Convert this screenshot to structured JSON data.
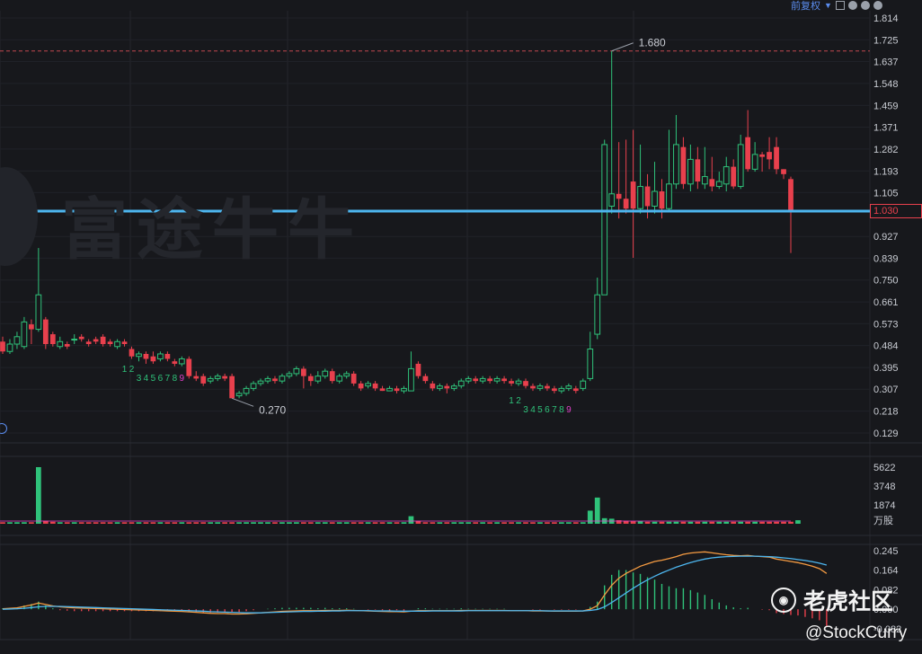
{
  "toolbar": {
    "adjust_label": "前复权",
    "chevron": "chevron-down-icon"
  },
  "watermark": {
    "text": "富途牛牛"
  },
  "community": {
    "name": "老虎社区",
    "handle": "@StockCurry"
  },
  "colors": {
    "up": "#2fc27a",
    "down": "#e8404d",
    "ma_line": "#4db6ef",
    "dif": "#f59b42",
    "dea": "#4db6ef",
    "vol_ma": "#e040c8"
  },
  "chart_data": [
    {
      "type": "candlestick",
      "price_axis_ticks": [
        "1.814",
        "1.725",
        "1.637",
        "1.548",
        "1.459",
        "1.371",
        "1.282",
        "1.193",
        "1.105",
        "1.030",
        "0.927",
        "0.839",
        "0.750",
        "0.661",
        "0.573",
        "0.484",
        "0.395",
        "0.307",
        "0.218",
        "0.129"
      ],
      "ylim": [
        0.129,
        1.814
      ],
      "current_price": 1.03,
      "current_price_label": "1.030",
      "high_marker": {
        "value": 1.68,
        "label": "1.680"
      },
      "low_marker": {
        "value": 0.27,
        "label": "0.270"
      },
      "candles": [
        [
          0.5,
          0.46,
          0.52,
          0.45
        ],
        [
          0.46,
          0.49,
          0.51,
          0.45
        ],
        [
          0.49,
          0.52,
          0.54,
          0.47
        ],
        [
          0.48,
          0.58,
          0.6,
          0.47
        ],
        [
          0.57,
          0.55,
          0.59,
          0.49
        ],
        [
          0.55,
          0.69,
          0.88,
          0.54
        ],
        [
          0.59,
          0.49,
          0.6,
          0.47
        ],
        [
          0.53,
          0.49,
          0.54,
          0.48
        ],
        [
          0.48,
          0.5,
          0.52,
          0.47
        ],
        [
          0.49,
          0.48,
          0.5,
          0.47
        ],
        [
          0.51,
          0.51,
          0.53,
          0.49
        ],
        [
          0.52,
          0.51,
          0.53,
          0.5
        ],
        [
          0.5,
          0.49,
          0.51,
          0.48
        ],
        [
          0.51,
          0.5,
          0.52,
          0.49
        ],
        [
          0.52,
          0.49,
          0.53,
          0.48
        ],
        [
          0.5,
          0.49,
          0.51,
          0.48
        ],
        [
          0.48,
          0.5,
          0.51,
          0.47
        ],
        [
          0.5,
          0.49,
          0.51,
          0.48
        ],
        [
          0.47,
          0.44,
          0.48,
          0.43
        ],
        [
          0.44,
          0.45,
          0.46,
          0.42
        ],
        [
          0.45,
          0.43,
          0.46,
          0.41
        ],
        [
          0.44,
          0.42,
          0.46,
          0.41
        ],
        [
          0.43,
          0.45,
          0.46,
          0.42
        ],
        [
          0.45,
          0.43,
          0.46,
          0.42
        ],
        [
          0.42,
          0.41,
          0.43,
          0.4
        ],
        [
          0.41,
          0.43,
          0.44,
          0.4
        ],
        [
          0.43,
          0.36,
          0.44,
          0.35
        ],
        [
          0.36,
          0.35,
          0.38,
          0.34
        ],
        [
          0.36,
          0.33,
          0.37,
          0.32
        ],
        [
          0.34,
          0.35,
          0.36,
          0.33
        ],
        [
          0.35,
          0.36,
          0.37,
          0.34
        ],
        [
          0.36,
          0.35,
          0.37,
          0.34
        ],
        [
          0.36,
          0.27,
          0.37,
          0.27
        ],
        [
          0.28,
          0.29,
          0.3,
          0.27
        ],
        [
          0.29,
          0.31,
          0.32,
          0.28
        ],
        [
          0.31,
          0.33,
          0.34,
          0.3
        ],
        [
          0.33,
          0.34,
          0.35,
          0.32
        ],
        [
          0.34,
          0.35,
          0.36,
          0.33
        ],
        [
          0.35,
          0.34,
          0.36,
          0.33
        ],
        [
          0.34,
          0.36,
          0.37,
          0.33
        ],
        [
          0.36,
          0.37,
          0.38,
          0.35
        ],
        [
          0.37,
          0.39,
          0.4,
          0.36
        ],
        [
          0.39,
          0.36,
          0.4,
          0.31
        ],
        [
          0.36,
          0.34,
          0.37,
          0.32
        ],
        [
          0.34,
          0.36,
          0.38,
          0.33
        ],
        [
          0.36,
          0.38,
          0.39,
          0.35
        ],
        [
          0.38,
          0.34,
          0.39,
          0.33
        ],
        [
          0.34,
          0.36,
          0.37,
          0.33
        ],
        [
          0.36,
          0.37,
          0.38,
          0.35
        ],
        [
          0.37,
          0.33,
          0.38,
          0.32
        ],
        [
          0.33,
          0.31,
          0.34,
          0.3
        ],
        [
          0.32,
          0.33,
          0.34,
          0.31
        ],
        [
          0.33,
          0.31,
          0.34,
          0.3
        ],
        [
          0.31,
          0.3,
          0.32,
          0.3
        ],
        [
          0.3,
          0.31,
          0.32,
          0.3
        ],
        [
          0.31,
          0.3,
          0.32,
          0.29
        ],
        [
          0.3,
          0.31,
          0.32,
          0.29
        ],
        [
          0.3,
          0.39,
          0.46,
          0.3
        ],
        [
          0.41,
          0.36,
          0.42,
          0.35
        ],
        [
          0.36,
          0.34,
          0.37,
          0.33
        ],
        [
          0.33,
          0.31,
          0.34,
          0.3
        ],
        [
          0.31,
          0.32,
          0.33,
          0.3
        ],
        [
          0.32,
          0.31,
          0.33,
          0.29
        ],
        [
          0.31,
          0.32,
          0.33,
          0.3
        ],
        [
          0.32,
          0.34,
          0.35,
          0.31
        ],
        [
          0.34,
          0.35,
          0.36,
          0.33
        ],
        [
          0.35,
          0.34,
          0.36,
          0.33
        ],
        [
          0.34,
          0.35,
          0.36,
          0.33
        ],
        [
          0.35,
          0.34,
          0.36,
          0.33
        ],
        [
          0.34,
          0.35,
          0.36,
          0.33
        ],
        [
          0.35,
          0.34,
          0.36,
          0.33
        ],
        [
          0.34,
          0.33,
          0.35,
          0.32
        ],
        [
          0.33,
          0.34,
          0.35,
          0.32
        ],
        [
          0.34,
          0.32,
          0.35,
          0.31
        ],
        [
          0.32,
          0.31,
          0.33,
          0.3
        ],
        [
          0.31,
          0.32,
          0.33,
          0.3
        ],
        [
          0.32,
          0.31,
          0.33,
          0.3
        ],
        [
          0.31,
          0.3,
          0.32,
          0.29
        ],
        [
          0.3,
          0.31,
          0.32,
          0.29
        ],
        [
          0.31,
          0.32,
          0.33,
          0.3
        ],
        [
          0.31,
          0.3,
          0.32,
          0.29
        ],
        [
          0.31,
          0.34,
          0.35,
          0.3
        ],
        [
          0.35,
          0.47,
          0.54,
          0.34
        ],
        [
          0.53,
          0.69,
          0.76,
          0.51
        ],
        [
          0.69,
          1.3,
          1.32,
          0.69
        ],
        [
          1.05,
          1.1,
          1.68,
          1.02
        ],
        [
          1.1,
          1.08,
          1.31,
          1.0
        ],
        [
          1.08,
          1.04,
          1.32,
          1.02
        ],
        [
          1.15,
          1.04,
          1.36,
          0.84
        ],
        [
          1.04,
          1.13,
          1.3,
          1.02
        ],
        [
          1.13,
          1.05,
          1.18,
          1.0
        ],
        [
          1.05,
          1.11,
          1.23,
          1.02
        ],
        [
          1.11,
          1.04,
          1.16,
          1.0
        ],
        [
          1.04,
          1.14,
          1.36,
          1.03
        ],
        [
          1.14,
          1.3,
          1.42,
          1.12
        ],
        [
          1.29,
          1.14,
          1.33,
          1.12
        ],
        [
          1.14,
          1.24,
          1.3,
          1.11
        ],
        [
          1.24,
          1.15,
          1.29,
          1.12
        ],
        [
          1.14,
          1.17,
          1.29,
          1.12
        ],
        [
          1.16,
          1.13,
          1.25,
          1.11
        ],
        [
          1.13,
          1.15,
          1.19,
          1.12
        ],
        [
          1.14,
          1.21,
          1.25,
          1.11
        ],
        [
          1.21,
          1.13,
          1.24,
          1.12
        ],
        [
          1.13,
          1.3,
          1.34,
          1.12
        ],
        [
          1.33,
          1.2,
          1.44,
          1.19
        ],
        [
          1.2,
          1.26,
          1.31,
          1.19
        ],
        [
          1.26,
          1.25,
          1.27,
          1.19
        ],
        [
          1.27,
          1.24,
          1.33,
          1.2
        ],
        [
          1.29,
          1.2,
          1.33,
          1.18
        ],
        [
          1.2,
          1.18,
          1.2,
          1.16
        ],
        [
          1.16,
          1.03,
          1.17,
          0.86
        ]
      ],
      "tx_numbers_a": [
        "1",
        "2",
        "3",
        "4",
        "5",
        "6",
        "7",
        "8",
        "9"
      ],
      "tx_numbers_b": [
        "1",
        "2",
        "3",
        "4",
        "5",
        "6",
        "7",
        "8",
        "9"
      ]
    },
    {
      "type": "bar",
      "name": "volume",
      "axis_ticks": [
        "5622",
        "3748",
        "1874"
      ],
      "unit_label": "万股",
      "ylim": [
        0,
        5622
      ],
      "values_x10k": [
        150,
        150,
        150,
        150,
        150,
        5622,
        300,
        200,
        150,
        150,
        150,
        150,
        150,
        150,
        150,
        150,
        150,
        150,
        150,
        150,
        150,
        150,
        150,
        150,
        150,
        150,
        150,
        150,
        150,
        150,
        150,
        150,
        150,
        150,
        150,
        150,
        150,
        150,
        150,
        150,
        150,
        150,
        150,
        150,
        150,
        150,
        150,
        150,
        150,
        150,
        150,
        150,
        150,
        150,
        150,
        150,
        150,
        750,
        300,
        150,
        150,
        150,
        150,
        150,
        150,
        150,
        150,
        150,
        150,
        150,
        150,
        150,
        150,
        150,
        150,
        150,
        150,
        150,
        150,
        150,
        150,
        150,
        1300,
        2600,
        550,
        500,
        350,
        300,
        250,
        250,
        200,
        200,
        200,
        200,
        200,
        200,
        200,
        200,
        200,
        200,
        200,
        200,
        200,
        200,
        200,
        200,
        200,
        200,
        200,
        200,
        200,
        350
      ]
    },
    {
      "type": "line",
      "name": "MACD",
      "axis_ticks": [
        "0.245",
        "0.164",
        "0.082",
        "0.000",
        "-0.082"
      ],
      "ylim": [
        -0.082,
        0.245
      ],
      "dif": [
        0.002,
        0.004,
        0.006,
        0.012,
        0.018,
        0.026,
        0.02,
        0.014,
        0.01,
        0.008,
        0.006,
        0.005,
        0.004,
        0.003,
        0.002,
        0.001,
        0.0,
        -0.001,
        -0.002,
        -0.003,
        -0.004,
        -0.005,
        -0.006,
        -0.007,
        -0.008,
        -0.009,
        -0.011,
        -0.013,
        -0.015,
        -0.017,
        -0.018,
        -0.018,
        -0.02,
        -0.02,
        -0.019,
        -0.017,
        -0.015,
        -0.013,
        -0.011,
        -0.009,
        -0.008,
        -0.007,
        -0.006,
        -0.006,
        -0.006,
        -0.005,
        -0.005,
        -0.005,
        -0.004,
        -0.005,
        -0.006,
        -0.007,
        -0.008,
        -0.009,
        -0.01,
        -0.01,
        -0.011,
        -0.008,
        -0.006,
        -0.006,
        -0.006,
        -0.006,
        -0.006,
        -0.006,
        -0.005,
        -0.005,
        -0.005,
        -0.005,
        -0.005,
        -0.005,
        -0.005,
        -0.006,
        -0.006,
        -0.006,
        -0.007,
        -0.007,
        -0.007,
        -0.008,
        -0.008,
        -0.008,
        -0.008,
        -0.007,
        0.0,
        0.015,
        0.06,
        0.1,
        0.13,
        0.15,
        0.165,
        0.18,
        0.19,
        0.2,
        0.205,
        0.212,
        0.22,
        0.23,
        0.235,
        0.238,
        0.24,
        0.236,
        0.232,
        0.228,
        0.225,
        0.224,
        0.225,
        0.222,
        0.22,
        0.218,
        0.21,
        0.205,
        0.2,
        0.195,
        0.188,
        0.18,
        0.17,
        0.15
      ],
      "dea": [
        0.0,
        0.001,
        0.002,
        0.004,
        0.007,
        0.01,
        0.012,
        0.012,
        0.012,
        0.011,
        0.01,
        0.009,
        0.008,
        0.007,
        0.006,
        0.005,
        0.004,
        0.003,
        0.002,
        0.001,
        0.0,
        -0.001,
        -0.002,
        -0.003,
        -0.004,
        -0.005,
        -0.006,
        -0.007,
        -0.008,
        -0.01,
        -0.011,
        -0.012,
        -0.013,
        -0.014,
        -0.015,
        -0.015,
        -0.015,
        -0.014,
        -0.013,
        -0.012,
        -0.011,
        -0.01,
        -0.009,
        -0.009,
        -0.008,
        -0.008,
        -0.007,
        -0.007,
        -0.006,
        -0.006,
        -0.006,
        -0.006,
        -0.007,
        -0.007,
        -0.007,
        -0.008,
        -0.008,
        -0.008,
        -0.008,
        -0.008,
        -0.007,
        -0.007,
        -0.007,
        -0.007,
        -0.007,
        -0.006,
        -0.006,
        -0.006,
        -0.006,
        -0.006,
        -0.006,
        -0.006,
        -0.006,
        -0.006,
        -0.006,
        -0.006,
        -0.007,
        -0.007,
        -0.007,
        -0.007,
        -0.007,
        -0.007,
        -0.005,
        -0.001,
        0.01,
        0.028,
        0.048,
        0.068,
        0.088,
        0.106,
        0.123,
        0.138,
        0.152,
        0.164,
        0.176,
        0.186,
        0.195,
        0.203,
        0.21,
        0.215,
        0.218,
        0.22,
        0.221,
        0.222,
        0.222,
        0.222,
        0.221,
        0.22,
        0.218,
        0.215,
        0.212,
        0.208,
        0.204,
        0.199,
        0.193,
        0.185
      ]
    }
  ]
}
